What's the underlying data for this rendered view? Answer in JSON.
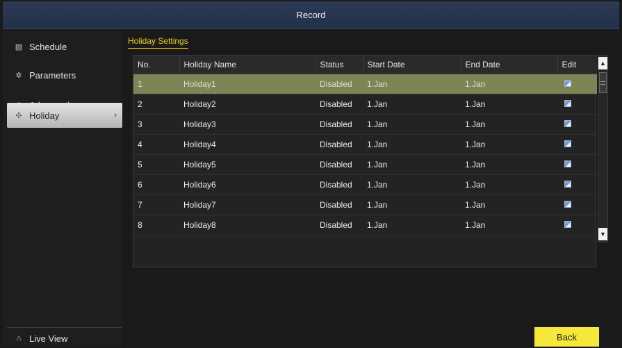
{
  "window": {
    "title": "Record"
  },
  "sidebar": {
    "items": [
      {
        "label": "Schedule",
        "icon": "schedule-icon",
        "glyph": "▤"
      },
      {
        "label": "Parameters",
        "icon": "gear-icon",
        "glyph": "✲"
      },
      {
        "label": "Advanced",
        "icon": "advanced-gear-icon",
        "glyph": "⚙"
      },
      {
        "label": "Holiday",
        "icon": "holiday-icon",
        "glyph": "✣",
        "active": true
      }
    ],
    "chevron": "›",
    "live_view": {
      "label": "Live View",
      "icon": "home-icon",
      "glyph": "⌂"
    }
  },
  "main": {
    "section_title": "Holiday Settings",
    "table": {
      "columns": [
        "No.",
        "Holiday Name",
        "Status",
        "Start Date",
        "End Date",
        "Edit"
      ],
      "rows": [
        {
          "no": "1",
          "name": "Holiday1",
          "status": "Disabled",
          "start": "1.Jan",
          "end": "1.Jan"
        },
        {
          "no": "2",
          "name": "Holiday2",
          "status": "Disabled",
          "start": "1.Jan",
          "end": "1.Jan"
        },
        {
          "no": "3",
          "name": "Holiday3",
          "status": "Disabled",
          "start": "1.Jan",
          "end": "1.Jan"
        },
        {
          "no": "4",
          "name": "Holiday4",
          "status": "Disabled",
          "start": "1.Jan",
          "end": "1.Jan"
        },
        {
          "no": "5",
          "name": "Holiday5",
          "status": "Disabled",
          "start": "1.Jan",
          "end": "1.Jan"
        },
        {
          "no": "6",
          "name": "Holiday6",
          "status": "Disabled",
          "start": "1.Jan",
          "end": "1.Jan"
        },
        {
          "no": "7",
          "name": "Holiday7",
          "status": "Disabled",
          "start": "1.Jan",
          "end": "1.Jan"
        },
        {
          "no": "8",
          "name": "Holiday8",
          "status": "Disabled",
          "start": "1.Jan",
          "end": "1.Jan"
        }
      ],
      "selected_row": "1"
    },
    "scroll": {
      "up_glyph": "▲",
      "down_glyph": "▼"
    },
    "back_label": "Back"
  },
  "colors": {
    "accent_yellow": "#f5e83a",
    "section_title": "#f2d11a",
    "selected_row": "#7d8456",
    "title_bar": "#22304a"
  }
}
